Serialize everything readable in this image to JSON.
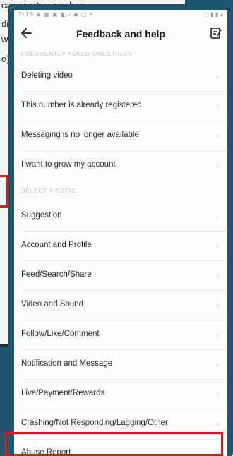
{
  "background": {
    "lines": [
      "can create and share",
      "di",
      "wi",
      "o)"
    ]
  },
  "status_bar": {
    "left": "2:19 ◈ ▦ ▣ ◧ ⁄ ◆ ▢ •",
    "right": "◌ ▮ ▮ ▴"
  },
  "header": {
    "title": "Feedback and help"
  },
  "sections": {
    "faq_label": "FREQUENTLY ASKED QUESTIONS",
    "topic_label": "SELECT A TOPIC"
  },
  "faq_items": [
    {
      "label": "Deleting video"
    },
    {
      "label": "This number is already registered"
    },
    {
      "label": "Messaging is no longer available"
    },
    {
      "label": "I want to grow my account"
    }
  ],
  "topic_items": [
    {
      "label": "Suggestion"
    },
    {
      "label": "Account and Profile"
    },
    {
      "label": "Feed/Search/Share"
    },
    {
      "label": "Video and Sound"
    },
    {
      "label": "Follow/Like/Comment"
    },
    {
      "label": "Notification and Message"
    },
    {
      "label": "Live/Payment/Rewards"
    },
    {
      "label": "Crashing/Not Responding/Lagging/Other"
    },
    {
      "label": "Abuse Report"
    }
  ],
  "chevron": "›",
  "colors": {
    "frame": "#1e5570",
    "highlight": "#d61a1a",
    "screen": "#fbfbfb"
  }
}
